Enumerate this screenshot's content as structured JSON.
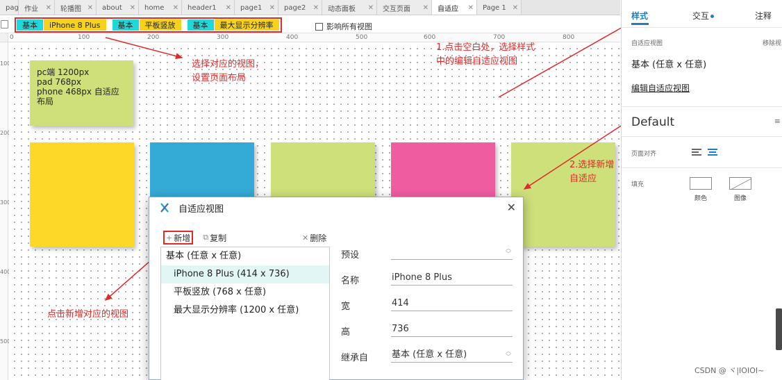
{
  "tabs": [
    "page",
    "作业",
    "轮播图",
    "about",
    "home",
    "header1",
    "page1",
    "page2",
    "动态面板",
    "交互页面",
    "自适应",
    "Page 1"
  ],
  "active_tab": "自适应",
  "views": [
    "基本",
    "iPhone 8 Plus",
    "基本",
    "平板竖放",
    "基本",
    "最大显示分辨率"
  ],
  "affect_all_label": "影响所有视图",
  "ruler": {
    "top": [
      "100",
      "200",
      "300",
      "400",
      "500",
      "600",
      "700",
      "800"
    ],
    "left": [
      "100",
      "200",
      "300",
      "400",
      "500"
    ]
  },
  "note_text": "pc端 1200px\npad 768px\nphone 468px 自适应布局",
  "boxes": [
    {
      "name": "yellow-box",
      "color": "#fdd826"
    },
    {
      "name": "blue-box",
      "color": "#34aad6"
    },
    {
      "name": "green-box",
      "color": "#cde07a"
    },
    {
      "name": "pink-box",
      "color": "#ef5da1"
    },
    {
      "name": "green-box-2",
      "color": "#cde07a"
    }
  ],
  "annotations": {
    "select_view": "选择对应的视图，\n设置页面布局",
    "step1": "1.点击空白处，选择样式\n中的编辑自适应视图",
    "step2": "2.选择新增\n自适应",
    "click_add": "点击新增对应的视图"
  },
  "dialog": {
    "title": "自适应视图",
    "add_label": "新增",
    "copy_label": "复制",
    "delete_label": "删除",
    "list": [
      "基本 (任意 x 任意)",
      "iPhone 8 Plus (414 x 736)",
      "平板竖放 (768 x 任意)",
      "最大显示分辨率 (1200 x 任意)"
    ],
    "form": {
      "preset_label": "预设",
      "preset_value": "",
      "name_label": "名称",
      "name_value": "iPhone 8 Plus",
      "width_label": "宽",
      "width_value": "414",
      "height_label": "高",
      "height_value": "736",
      "inherit_label": "继承自",
      "inherit_value": "基本 (任意 x 任意)"
    }
  },
  "panel": {
    "tab_style": "样式",
    "tab_interact": "交互",
    "tab_notes": "注释",
    "adaptive_label": "自适应视图",
    "remove_label": "移除视",
    "adaptive_value": "基本 (任意 x 任意)",
    "edit_link": "编辑自适应视图",
    "default_label": "Default",
    "align_label": "页面对齐",
    "fill_label": "填充",
    "fill_color": "颜色",
    "fill_image": "图像"
  },
  "watermark": "CSDN @ ヾ|IOIOI~"
}
